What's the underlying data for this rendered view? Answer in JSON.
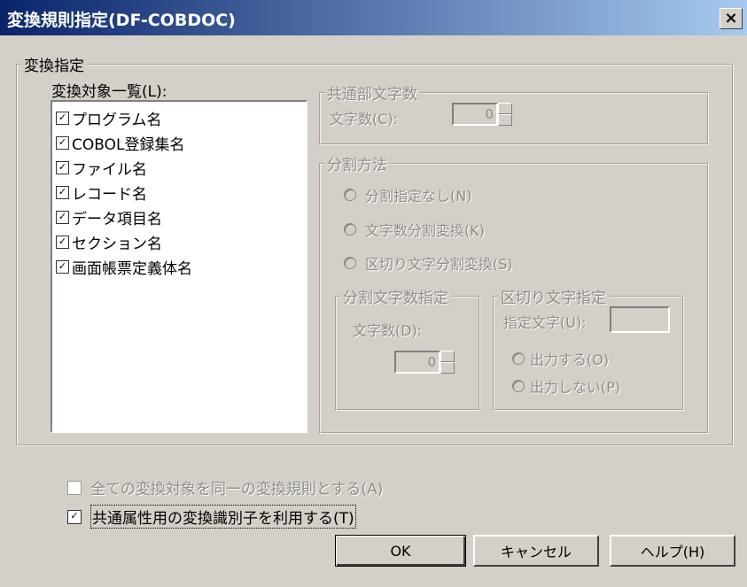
{
  "window": {
    "title": "変換規則指定(DF-COBDOC)",
    "close_label": "×"
  },
  "conversion": {
    "group_label": "変換指定",
    "list_label": "変換対象一覧(L):",
    "items": [
      {
        "label": "プログラム名",
        "checked": true
      },
      {
        "label": "COBOL登録集名",
        "checked": true
      },
      {
        "label": "ファイル名",
        "checked": true
      },
      {
        "label": "レコード名",
        "checked": true
      },
      {
        "label": "データ項目名",
        "checked": true
      },
      {
        "label": "セクション名",
        "checked": true
      },
      {
        "label": "画面帳票定義体名",
        "checked": true
      }
    ],
    "common_chars": {
      "group_label": "共通部文字数",
      "field_label": "文字数(C):",
      "value": "0"
    },
    "split": {
      "group_label": "分割方法",
      "options": [
        "分割指定なし(N)",
        "文字数分割変換(K)",
        "区切り文字分割変換(S)"
      ],
      "char_count": {
        "group_label": "分割文字数指定",
        "field_label": "文字数(D):",
        "value": "0"
      },
      "delimiter": {
        "group_label": "区切り文字指定",
        "field_label": "指定文字(U):",
        "value": "",
        "options": [
          "出力する(O)",
          "出力しない(P)"
        ]
      }
    }
  },
  "options": {
    "same_rule": {
      "label": "全ての変換対象を同一の変換規則とする(A)",
      "checked": false,
      "enabled": false
    },
    "common_attr": {
      "label": "共通属性用の変換識別子を利用する(T)",
      "checked": true,
      "enabled": true
    }
  },
  "buttons": {
    "ok": "OK",
    "cancel": "キャンセル",
    "help": "ヘルプ(H)"
  },
  "check_mark": "✓"
}
